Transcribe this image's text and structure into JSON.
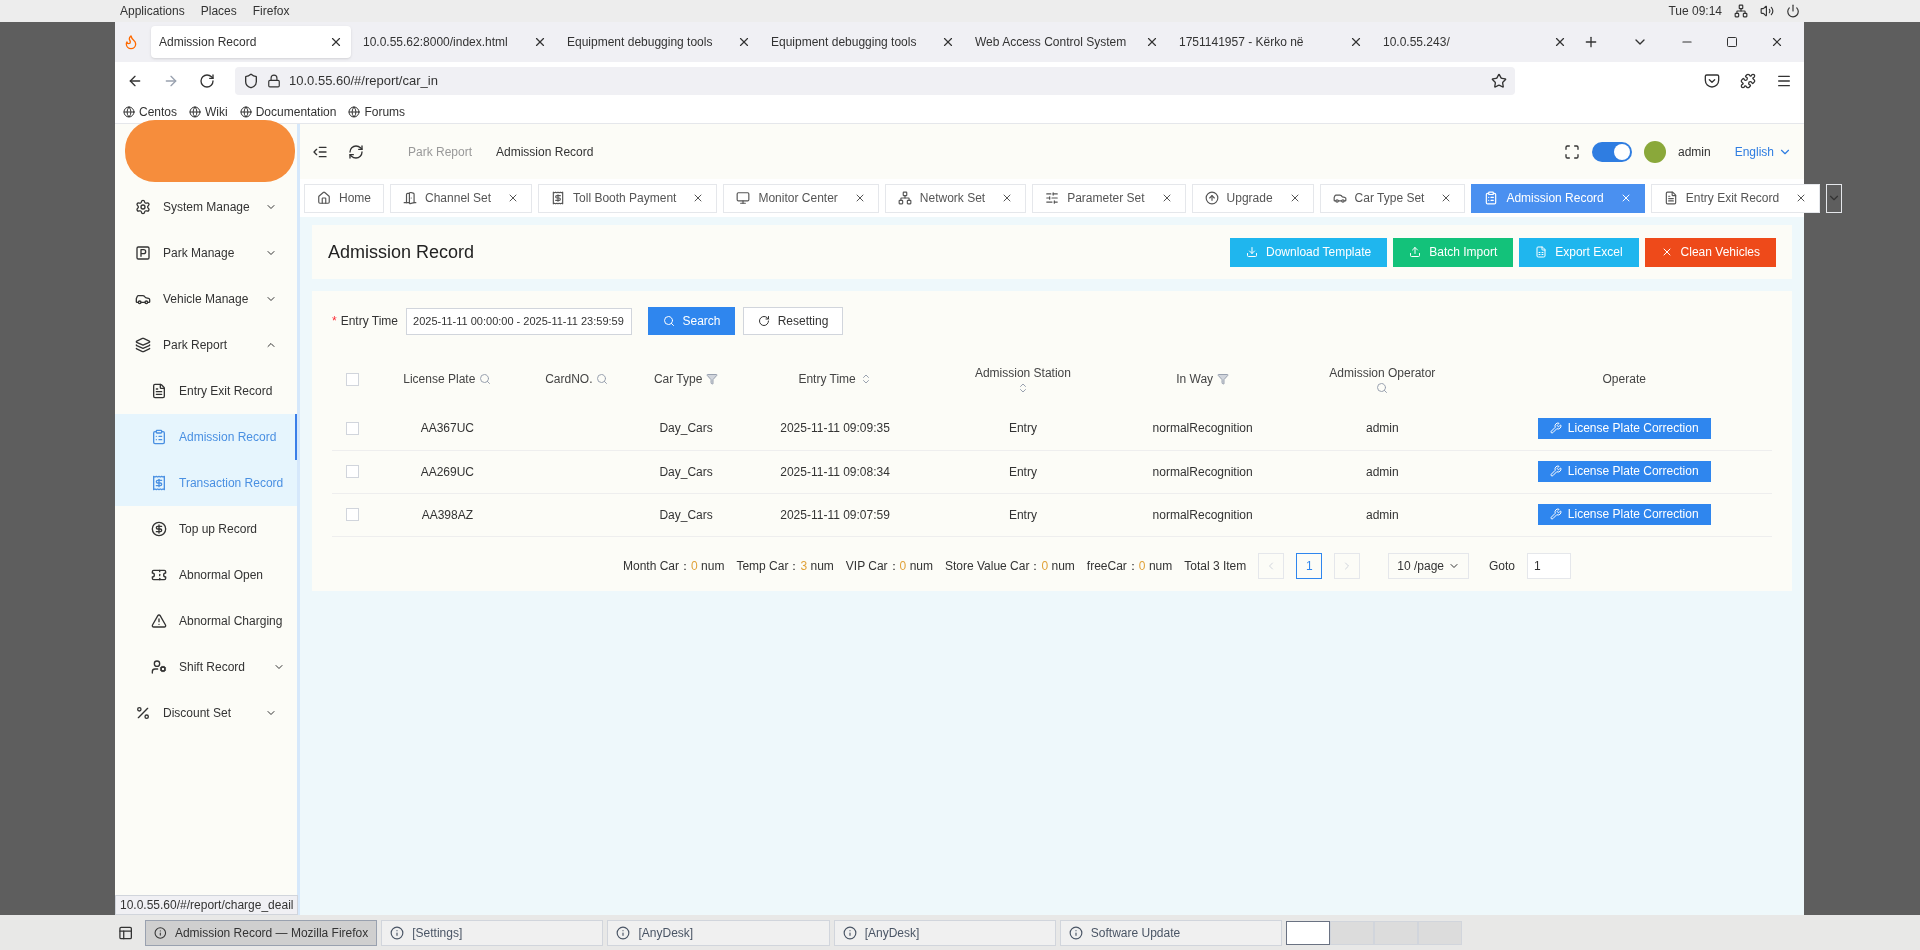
{
  "system_bar": {
    "menus": [
      "Applications",
      "Places",
      "Firefox"
    ],
    "time": "Tue 09:14"
  },
  "browser": {
    "tabs": [
      {
        "title": "Admission Record",
        "selected": true
      },
      {
        "title": "10.0.55.62:8000/index.html",
        "selected": false
      },
      {
        "title": "Equipment debugging tools",
        "selected": false
      },
      {
        "title": "Equipment debugging tools",
        "selected": false
      },
      {
        "title": "Web Access Control System",
        "selected": false
      },
      {
        "title": "1751141957 - Kërko në",
        "selected": false
      },
      {
        "title": "10.0.55.243/",
        "selected": false
      }
    ],
    "url": "10.0.55.60/#/report/car_in",
    "bookmarks": [
      "Centos",
      "Wiki",
      "Documentation",
      "Forums"
    ],
    "status_link": "10.0.55.60/#/report/charge_deail"
  },
  "header": {
    "breadcrumb": [
      "Park Report",
      "Admission Record"
    ],
    "toggle_on": true,
    "user": "admin",
    "language": "English"
  },
  "sidebar": {
    "items": [
      {
        "label": "System Manage",
        "expanded": false
      },
      {
        "label": "Park Manage",
        "expanded": false
      },
      {
        "label": "Vehicle Manage",
        "expanded": false
      },
      {
        "label": "Park Report",
        "expanded": true,
        "children": [
          {
            "label": "Entry Exit Record",
            "selected": false,
            "hovered": false
          },
          {
            "label": "Admission Record",
            "selected": true,
            "hovered": false
          },
          {
            "label": "Transaction Record",
            "selected": false,
            "hovered": true
          },
          {
            "label": "Top up Record",
            "selected": false,
            "hovered": false
          },
          {
            "label": "Abnormal Open",
            "selected": false,
            "hovered": false
          },
          {
            "label": "Abnormal Charging",
            "selected": false,
            "hovered": false
          },
          {
            "label": "Shift Record",
            "selected": false,
            "hovered": false,
            "expanded": false
          }
        ]
      },
      {
        "label": "Discount Set",
        "expanded": false
      }
    ]
  },
  "page_tabs": [
    {
      "label": "Home",
      "selected": false,
      "closable": false
    },
    {
      "label": "Channel Set",
      "selected": false,
      "closable": true
    },
    {
      "label": "Toll Booth Payment",
      "selected": false,
      "closable": true
    },
    {
      "label": "Monitor Center",
      "selected": false,
      "closable": true
    },
    {
      "label": "Network Set",
      "selected": false,
      "closable": true
    },
    {
      "label": "Parameter Set",
      "selected": false,
      "closable": true
    },
    {
      "label": "Upgrade",
      "selected": false,
      "closable": true
    },
    {
      "label": "Car Type Set",
      "selected": false,
      "closable": true
    },
    {
      "label": "Admission Record",
      "selected": true,
      "closable": true
    },
    {
      "label": "Entry Exit Record",
      "selected": false,
      "closable": true
    }
  ],
  "page_title": "Admission Record",
  "actions": [
    {
      "label": "Download Template",
      "color": "#1fb6ee"
    },
    {
      "label": "Batch Import",
      "color": "#13c27a"
    },
    {
      "label": "Export Excel",
      "color": "#1fb6ee"
    },
    {
      "label": "Clean Vehicles",
      "color": "#ee4a1a"
    }
  ],
  "filter": {
    "required_mark": "*",
    "label": "Entry Time",
    "value": "2025-11-11 00:00:00 - 2025-11-11 23:59:59",
    "search": "Search",
    "reset": "Resetting"
  },
  "table": {
    "all_checked": false,
    "columns": [
      {
        "label": "License Plate",
        "kind": "search"
      },
      {
        "label": "CardNO.",
        "kind": "search"
      },
      {
        "label": "Car Type",
        "kind": "filter"
      },
      {
        "label": "Entry Time",
        "kind": "sort"
      },
      {
        "label": "Admission Station",
        "kind": "sort"
      },
      {
        "label": "In Way",
        "kind": "filter"
      },
      {
        "label": "Admission Operator",
        "kind": "search"
      },
      {
        "label": "Operate",
        "kind": "plain"
      }
    ],
    "rows": [
      {
        "checked": false,
        "cells": [
          "AA367UC",
          "",
          "Day_Cars",
          "2025-11-11 09:09:35",
          "Entry",
          "normalRecognition",
          "admin"
        ],
        "action": "License Plate Correction"
      },
      {
        "checked": false,
        "cells": [
          "AA269UC",
          "",
          "Day_Cars",
          "2025-11-11 09:08:34",
          "Entry",
          "normalRecognition",
          "admin"
        ],
        "action": "License Plate Correction"
      },
      {
        "checked": false,
        "cells": [
          "AA398AZ",
          "",
          "Day_Cars",
          "2025-11-11 09:07:59",
          "Entry",
          "normalRecognition",
          "admin"
        ],
        "action": "License Plate Correction"
      }
    ]
  },
  "summary": [
    {
      "label": "Month Car：",
      "value": "0",
      "unit": "num"
    },
    {
      "label": "Temp Car：",
      "value": "3",
      "unit": "num"
    },
    {
      "label": "VIP Car：",
      "value": "0",
      "unit": "num"
    },
    {
      "label": "Store Value Car：",
      "value": "0",
      "unit": "num"
    },
    {
      "label": "freeCar：",
      "value": "0",
      "unit": "num"
    }
  ],
  "pagination": {
    "total": "Total 3 Item",
    "page": "1",
    "page_size": "10 /page",
    "goto_label": "Goto",
    "goto_value": "1"
  },
  "taskbar": {
    "items": [
      {
        "title": "Admission Record — Mozilla Firefox",
        "selected": true
      },
      {
        "title": "[Settings]",
        "selected": false
      },
      {
        "title": "[AnyDesk]",
        "selected": false
      },
      {
        "title": "[AnyDesk]",
        "selected": false
      },
      {
        "title": "Software Update",
        "selected": false
      }
    ],
    "workspaces": [
      {
        "selected": true
      },
      {
        "selected": false
      },
      {
        "selected": false
      },
      {
        "selected": false
      }
    ]
  }
}
